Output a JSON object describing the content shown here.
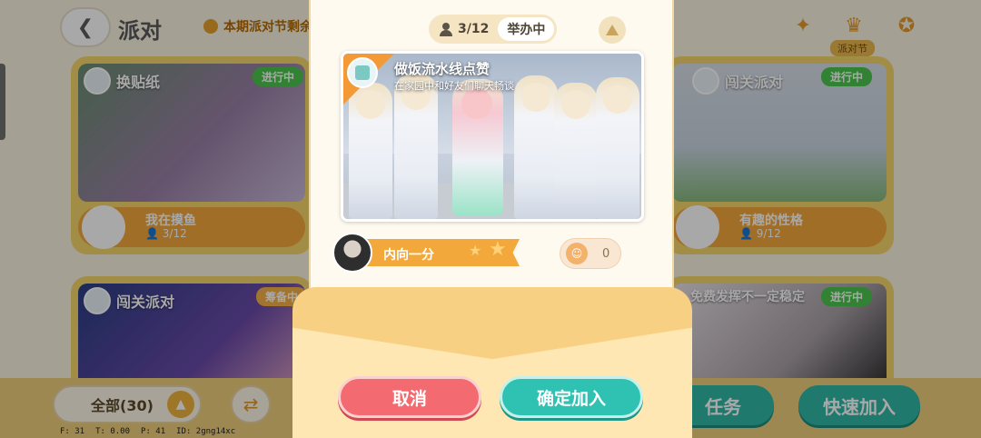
{
  "header": {
    "back_icon": "chevron-left-icon",
    "title": "派对",
    "timer_text": "本期派对节剩余",
    "party_festival_badge": "派对节"
  },
  "cards": [
    {
      "title": "换贴纸",
      "status": "进行中",
      "host_name": "我在摸鱼",
      "count": "3/12"
    },
    {
      "title": "闯关派对",
      "status": "进行中",
      "host_name": "有趣的性格",
      "count": "9/12"
    },
    {
      "title": "闯关派对",
      "status": "筹备中"
    },
    {
      "title": "免费发挥不一定稳定",
      "status": "进行中"
    }
  ],
  "bottom": {
    "filter_label": "全部(30)",
    "task_label": "任务",
    "quick_join_label": "快速加入"
  },
  "debug": {
    "f": "F: 31",
    "t": "T: 0.00",
    "p": "P: 41",
    "id": "ID: 2gng14xc"
  },
  "modal": {
    "member_count": "3/12",
    "state": "举办中",
    "party_title": "做饭流水线点赞",
    "party_subtitle": "在家园中和好友们聊天畅谈",
    "host_name": "内向一分",
    "like_count": "0",
    "cancel_label": "取消",
    "confirm_label": "确定加入"
  },
  "colors": {
    "accent_orange": "#f3a83c",
    "teal": "#2fc2b2",
    "cancel_red": "#f36a70",
    "status_green": "#4cc54e"
  }
}
